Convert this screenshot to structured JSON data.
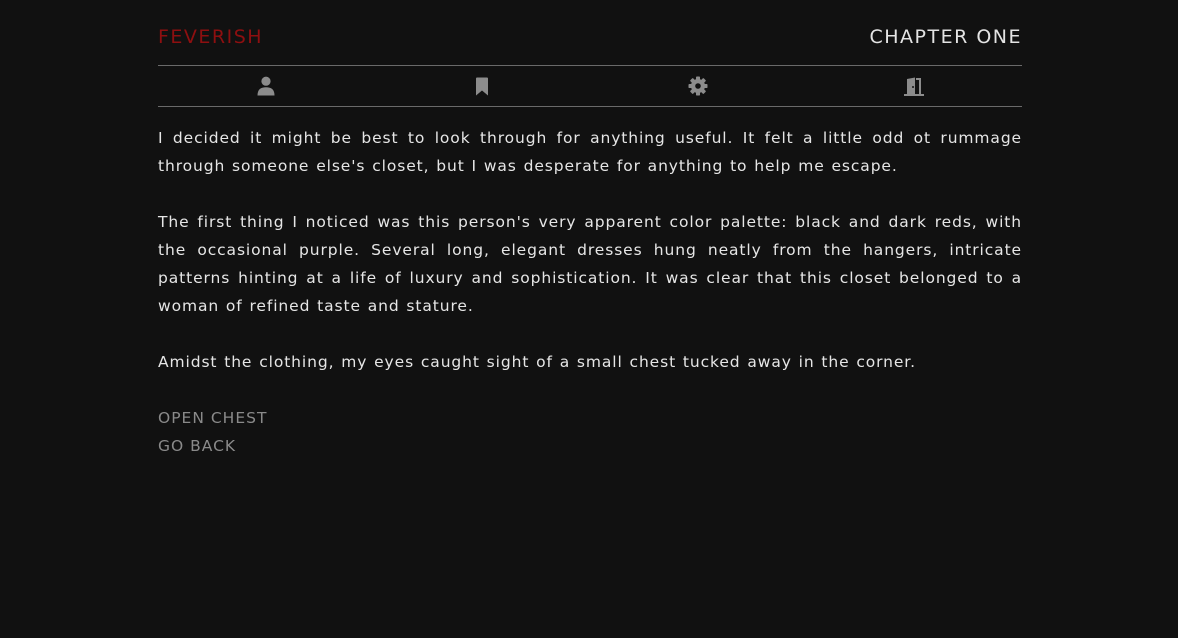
{
  "header": {
    "title": "FEVERISH",
    "chapter": "CHAPTER ONE"
  },
  "toolbar": {
    "items": [
      {
        "icon": "user-icon"
      },
      {
        "icon": "bookmark-icon"
      },
      {
        "icon": "gear-icon"
      },
      {
        "icon": "exit-door-icon"
      }
    ]
  },
  "story": {
    "paragraphs": [
      "I decided it might be best to look through for anything useful. It felt a little odd ot rummage through someone else's closet, but I was desperate for anything to help me escape.",
      "The first thing I noticed was this person's very apparent color palette: black and dark reds, with the occasional purple. Several long, elegant dresses hung neatly from the hangers, intricate patterns hinting at a life of luxury and sophistication. It was clear that this closet belonged to a woman of refined taste and stature.",
      "Amidst the clothing, my eyes caught sight of a small chest tucked away in the corner."
    ]
  },
  "choices": [
    "OPEN CHEST",
    "GO BACK"
  ],
  "colors": {
    "background": "#111111",
    "title": "#8e0f10",
    "text": "#e6e6e6",
    "choice": "#8a8a8a",
    "icon": "#8c8c8c",
    "divider": "#6a6a6a"
  }
}
